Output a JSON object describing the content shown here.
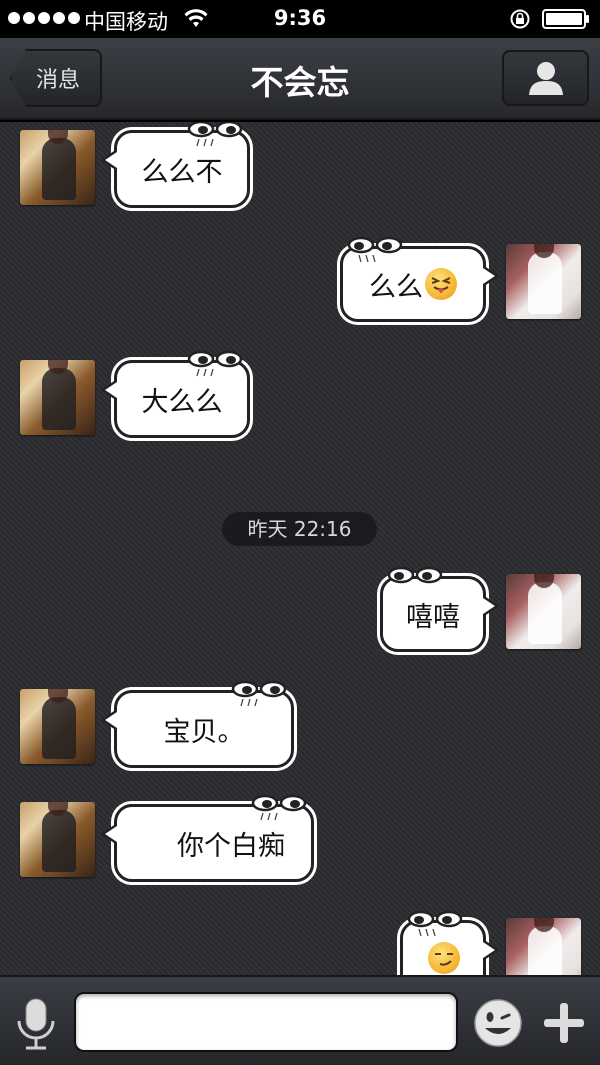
{
  "status_bar": {
    "carrier": "中国移动",
    "time": "9:36"
  },
  "nav": {
    "back_label": "消息",
    "title": "不会忘",
    "contact_icon": "person-icon"
  },
  "timestamp": "昨天 22:16",
  "messages": [
    {
      "side": "left",
      "text": "么么不"
    },
    {
      "side": "right",
      "text": "么么",
      "emoji": "tongue-out-emoji"
    },
    {
      "side": "left",
      "text": "大么么"
    },
    {
      "side": "right",
      "text": "嘻嘻"
    },
    {
      "side": "left",
      "text": "宝贝。"
    },
    {
      "side": "left",
      "text": "你个白痴"
    },
    {
      "side": "right",
      "text": "",
      "emoji": "smirk-emoji"
    }
  ],
  "input_bar": {
    "text_value": "",
    "mic_icon": "microphone-icon",
    "emoji_icon": "smiley-icon",
    "plus_icon": "plus-icon"
  },
  "colors": {
    "nav_bg": "#2f3136",
    "chat_bg": "#2a2c30",
    "bubble_bg": "#ffffff",
    "bubble_border": "#222222"
  }
}
